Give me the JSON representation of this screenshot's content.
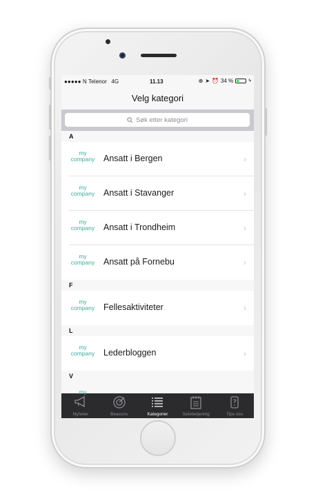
{
  "status_bar": {
    "carrier": "●●●●● N Telenor",
    "network": "4G",
    "time": "11.13",
    "battery_percent": "34 %",
    "battery_level": 0.34
  },
  "nav": {
    "title": "Velg kategori"
  },
  "search": {
    "placeholder": "Søk etter kategori"
  },
  "logo": {
    "line1": "my",
    "line2": "company"
  },
  "sections": [
    {
      "letter": "A",
      "items": [
        "Ansatt i Bergen",
        "Ansatt i Stavanger",
        "Ansatt i Trondheim",
        "Ansatt på Fornebu"
      ]
    },
    {
      "letter": "F",
      "items": [
        "Fellesaktiviteter"
      ]
    },
    {
      "letter": "L",
      "items": [
        "Lederbloggen"
      ]
    },
    {
      "letter": "V",
      "items": []
    }
  ],
  "tabs": [
    {
      "label": "Nyheter",
      "icon": "megaphone-icon",
      "active": false
    },
    {
      "label": "Beacons",
      "icon": "beacon-icon",
      "active": false
    },
    {
      "label": "Kategorier",
      "icon": "list-icon",
      "active": true
    },
    {
      "label": "Selvbetjening",
      "icon": "notepad-icon",
      "active": false
    },
    {
      "label": "Tips oss",
      "icon": "phone-tip-icon",
      "active": false
    }
  ],
  "colors": {
    "logo": "#3aaa9a",
    "tabbar": "#2b2b2d",
    "battery": "#4cd964"
  }
}
